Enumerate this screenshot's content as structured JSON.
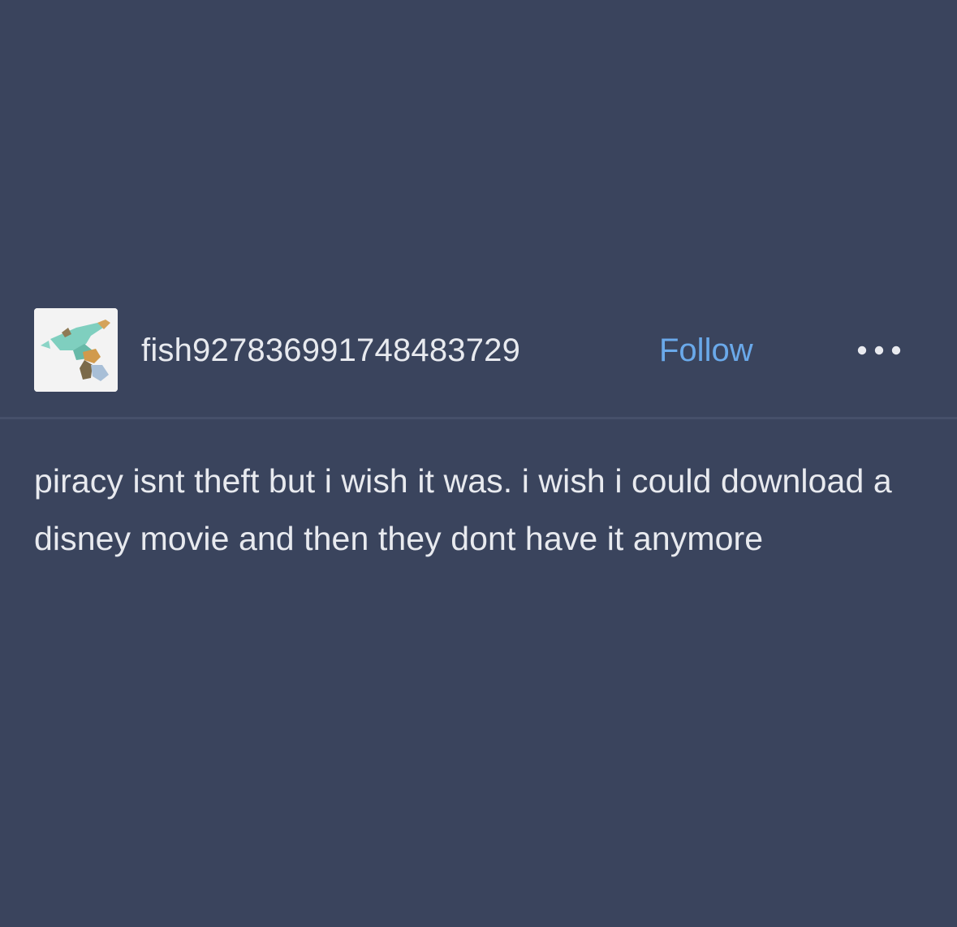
{
  "post": {
    "username": "fish927836991748483729",
    "follow_label": "Follow",
    "more_icon": "more-horizontal-icon",
    "avatar_icon": "blog-avatar-dragon-icon",
    "text": "piracy isnt theft but i wish it was. i wish i could download a disney movie and then they dont have it anymore"
  },
  "colors": {
    "background": "#3a445d",
    "text": "#e8eaef",
    "accent_link": "#6aa9ea",
    "divider": "#46506a"
  }
}
